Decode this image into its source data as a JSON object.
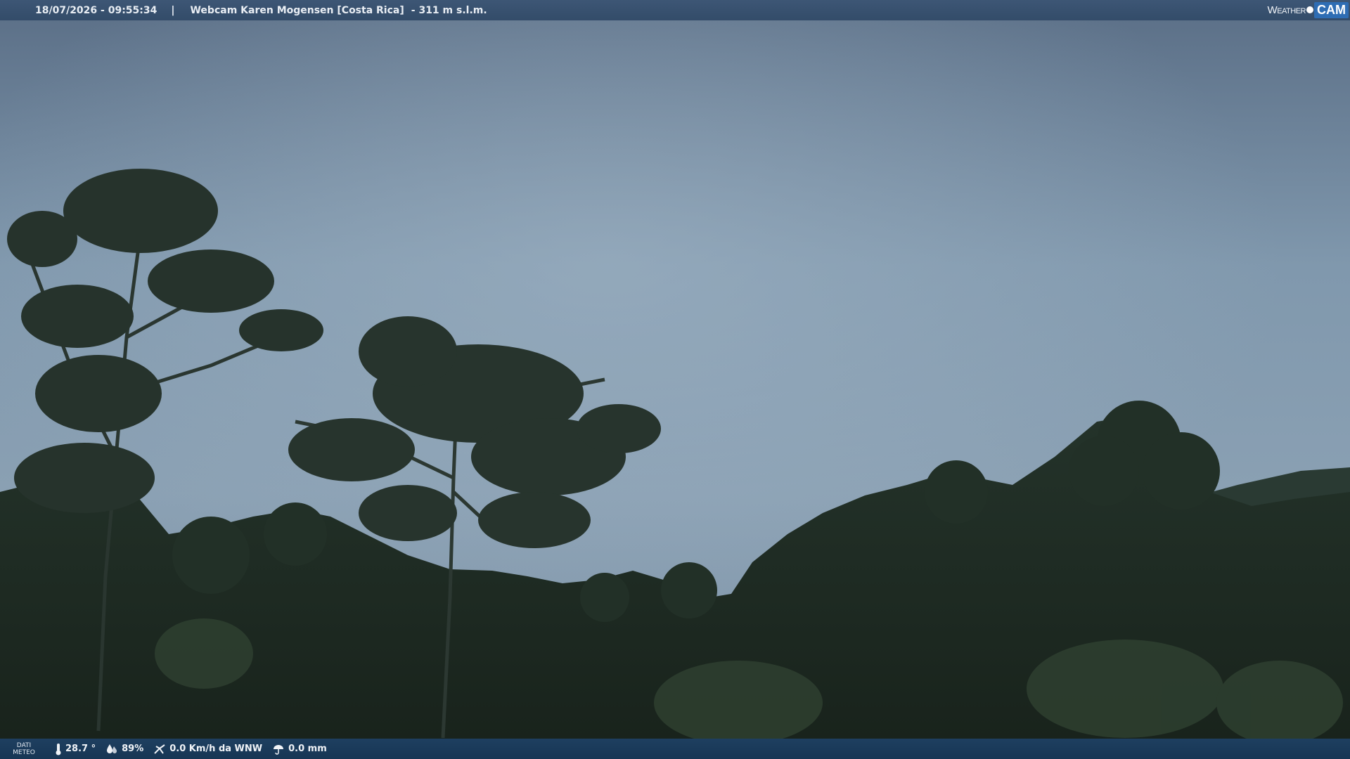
{
  "header": {
    "timestamp": "18/07/2026 - 09:55:34",
    "separator": "|",
    "title": "Webcam Karen Mogensen [Costa Rica]",
    "elevation": "- 311 m s.l.m."
  },
  "logo": {
    "weather": "Weather",
    "cam": "CAM"
  },
  "footer": {
    "dati_line1": "DATI",
    "dati_line2": "METEO",
    "temperature": "28.7 °",
    "humidity": "89%",
    "wind": "0.0 Km/h da WNW",
    "rain": "0.0 mm"
  },
  "colors": {
    "sky_top": "#5d7189",
    "sky_bottom": "#8ea4b7",
    "foliage": "#1e2b22",
    "header_bg": "#3a5473",
    "footer_bg": "#1c3b5b",
    "logo_accent": "#2e6db4"
  },
  "icons": [
    "thermometer-icon",
    "humidity-icon",
    "wind-icon",
    "rain-icon"
  ]
}
